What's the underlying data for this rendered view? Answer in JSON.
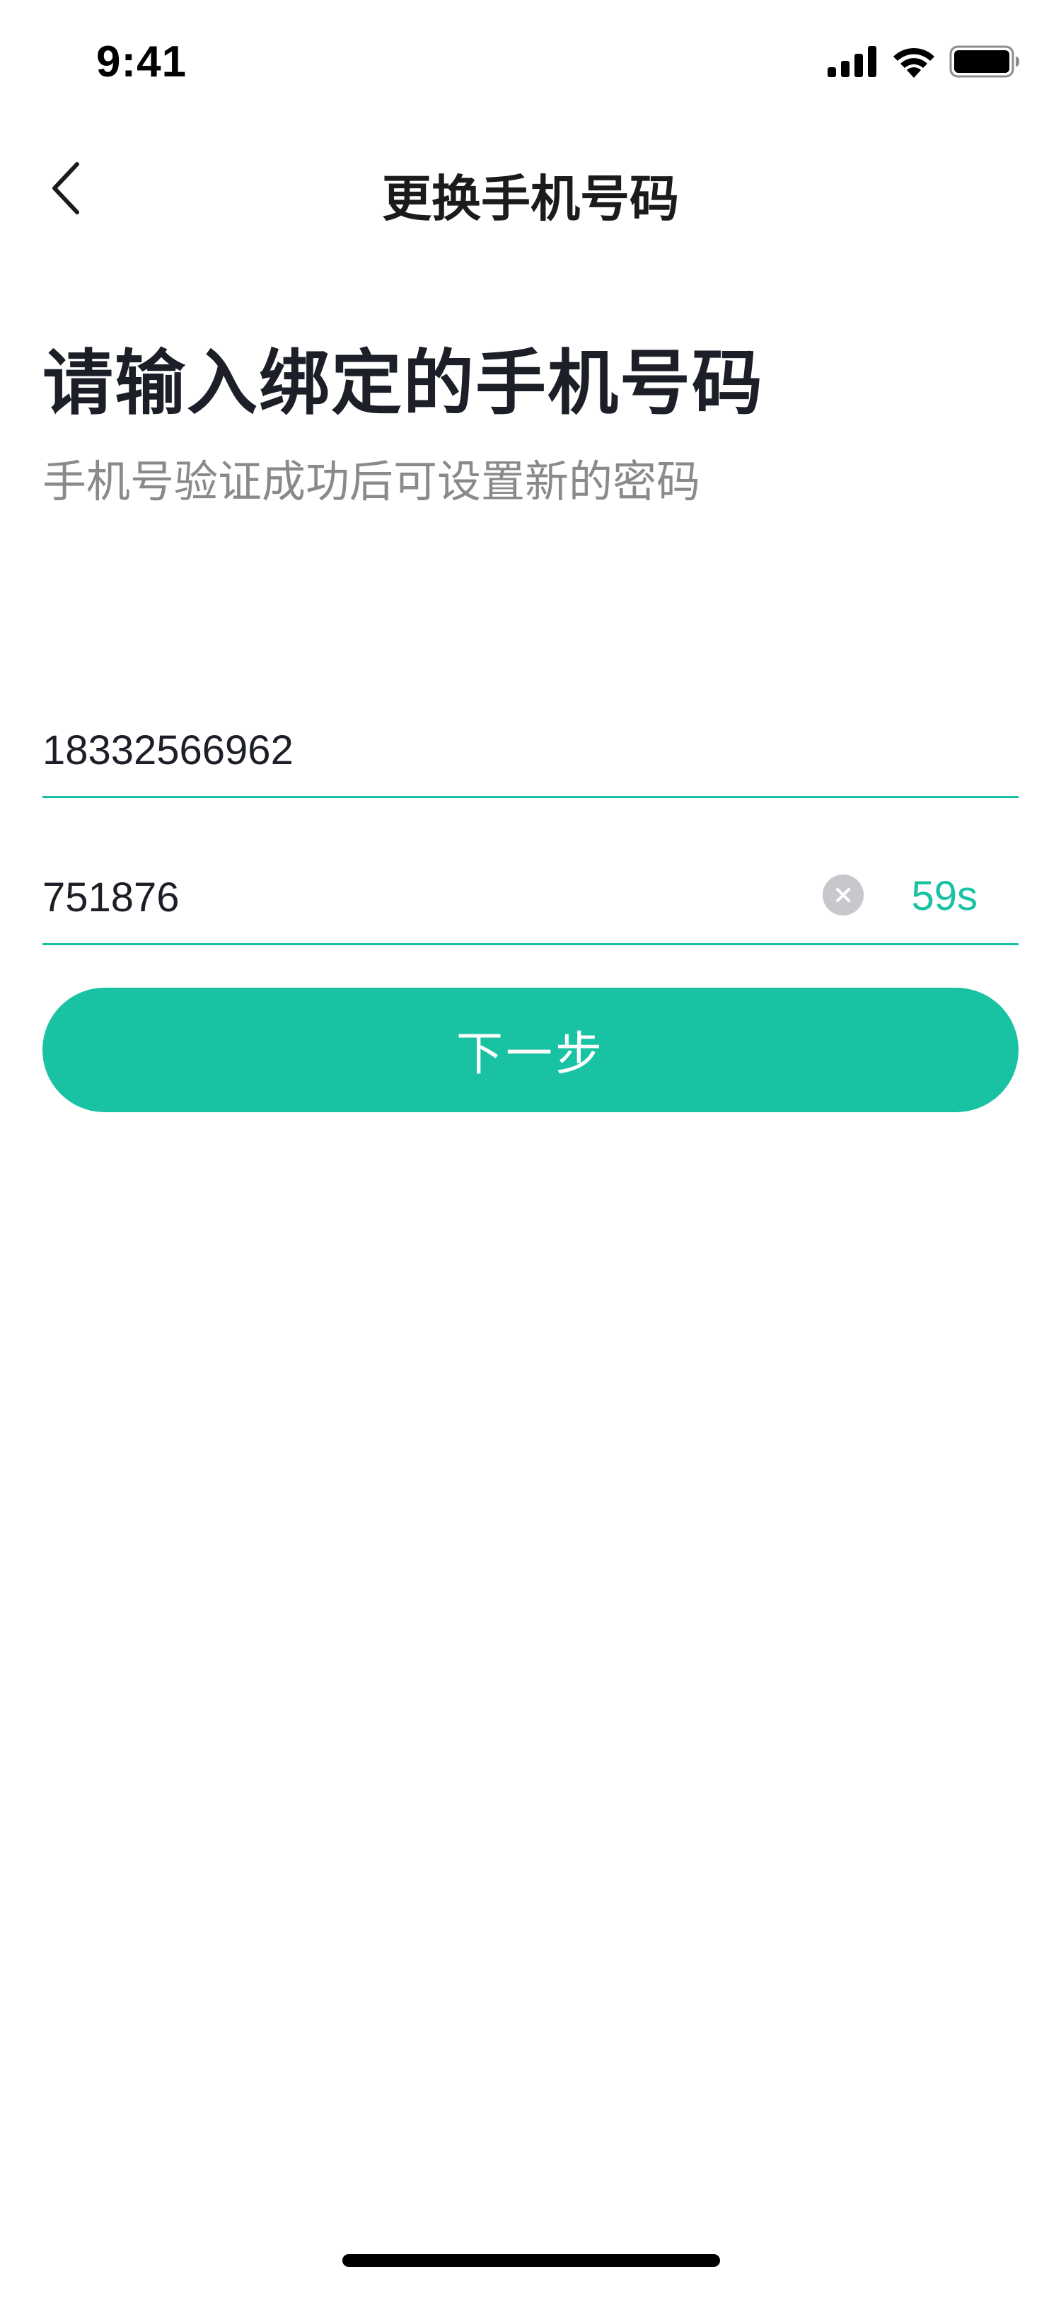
{
  "status_bar": {
    "time": "9:41"
  },
  "nav": {
    "back_icon": "chevron-left-icon",
    "title": "更换手机号码"
  },
  "main": {
    "headline": "请输入绑定的手机号码",
    "subhead": "手机号验证成功后可设置新的密码",
    "phone_value": "18332566962",
    "code_value": "751876",
    "clear_icon": "clear-circle-icon",
    "countdown": "59s",
    "next_label": "下一步"
  },
  "colors": {
    "accent": "#18c2a3",
    "title_text": "#1c1f27",
    "secondary_text": "#8a8a8a",
    "clear_icon_bg": "#c7c7cc"
  }
}
